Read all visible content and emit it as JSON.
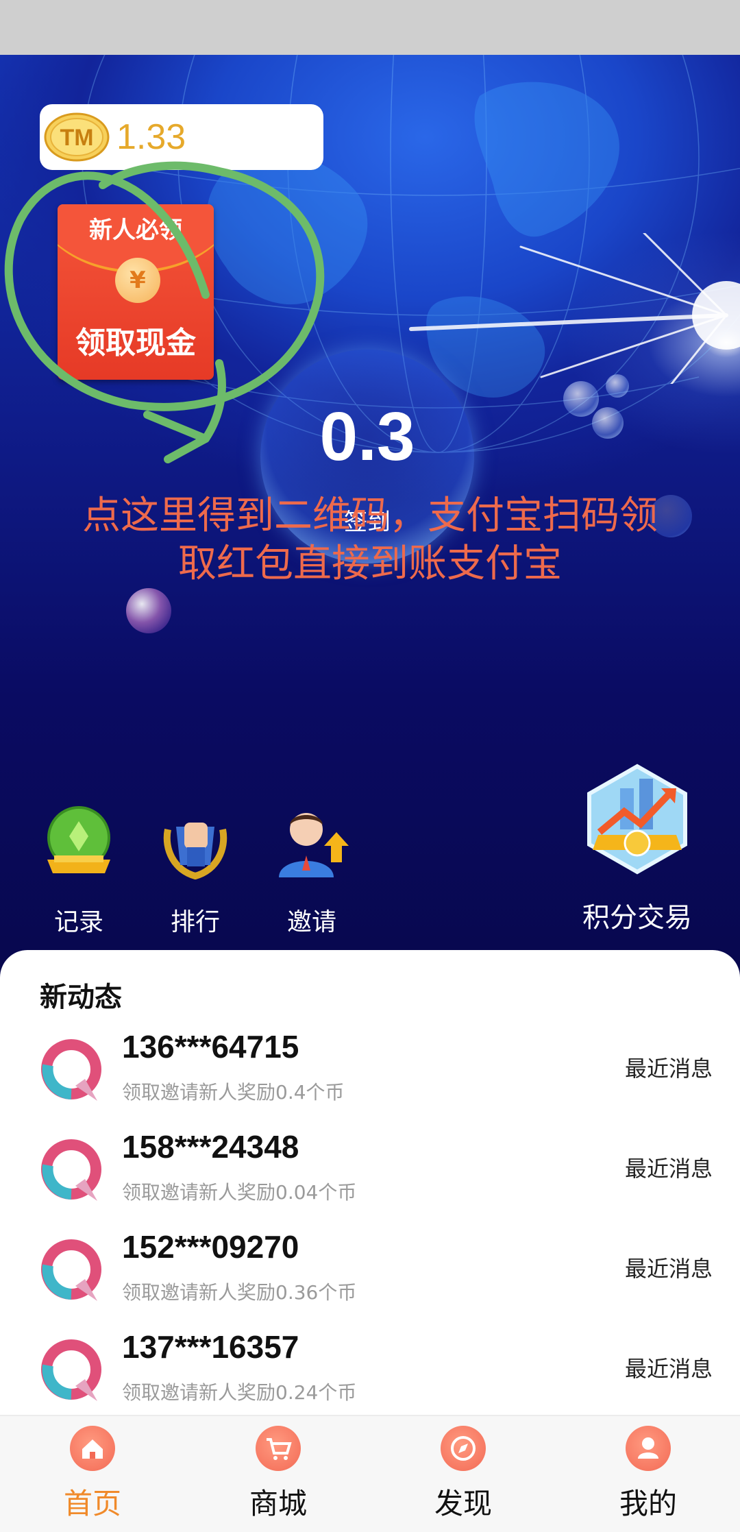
{
  "balance": {
    "logo_text": "TM",
    "value": "1.33"
  },
  "red_packet": {
    "top_text": "新人必领",
    "coin_symbol": "¥",
    "bottom_text": "领取现金"
  },
  "bubble": {
    "value": "0.3",
    "label": "签到"
  },
  "overlay_note": {
    "line1": "点这里得到二维码，支付宝扫码领",
    "line2": "取红包直接到账支付宝"
  },
  "actions": [
    {
      "label": "记录",
      "icon": "trophy-icon"
    },
    {
      "label": "排行",
      "icon": "ranking-fist-icon"
    },
    {
      "label": "邀请",
      "icon": "invite-person-icon"
    }
  ],
  "trade": {
    "label": "积分交易",
    "icon": "trade-chart-icon"
  },
  "feed": {
    "title": "新动态",
    "items": [
      {
        "phone": "136***64715",
        "desc": "领取邀请新人奖励0.4个币",
        "tag": "最近消息"
      },
      {
        "phone": "158***24348",
        "desc": "领取邀请新人奖励0.04个币",
        "tag": "最近消息"
      },
      {
        "phone": "152***09270",
        "desc": "领取邀请新人奖励0.36个币",
        "tag": "最近消息"
      },
      {
        "phone": "137***16357",
        "desc": "领取邀请新人奖励0.24个币",
        "tag": "最近消息"
      }
    ]
  },
  "tabs": [
    {
      "label": "首页",
      "icon": "home-icon",
      "active": true
    },
    {
      "label": "商城",
      "icon": "cart-icon",
      "active": false
    },
    {
      "label": "发现",
      "icon": "compass-icon",
      "active": false
    },
    {
      "label": "我的",
      "icon": "user-icon",
      "active": false
    }
  ],
  "colors": {
    "accent": "#f08a2a",
    "overlay_text": "#ee6a4c",
    "coin_value": "#e6a92b",
    "annotation_circle": "#6dbb6a"
  }
}
